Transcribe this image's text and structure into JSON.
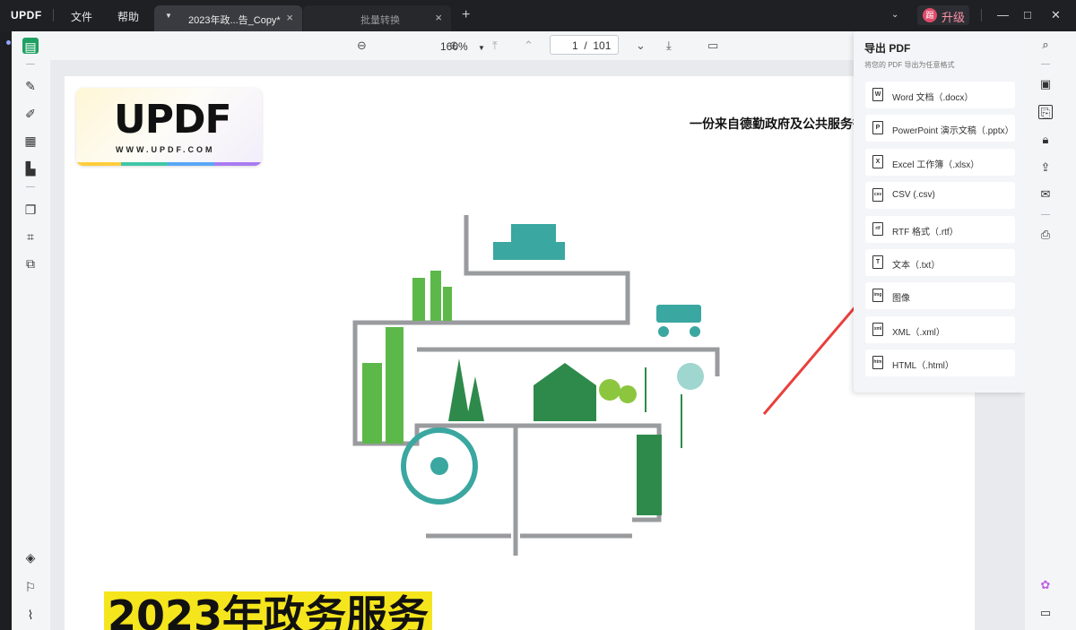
{
  "app": {
    "logo": "UPDF"
  },
  "menu": {
    "file": "文件",
    "help": "帮助"
  },
  "tabs": [
    {
      "label": "2023年政...告_Copy*",
      "active": true
    },
    {
      "label": "批量转换",
      "active": false
    }
  ],
  "window": {
    "upgrade_label": "升级",
    "upgrade_badge": "踢"
  },
  "toolbar": {
    "zoom": "160%",
    "page_current": "1",
    "page_total": "101",
    "page_sep": "/"
  },
  "document": {
    "logo_text": "UPDF",
    "logo_url": "WWW.UPDF.COM",
    "heading": "一份来自德勤政府及公共服务行",
    "title": "2023年政务服务"
  },
  "export_panel": {
    "title": "导出 PDF",
    "subtitle": "将您的 PDF 导出为任意格式",
    "items": [
      {
        "label": "Word 文档（.docx）",
        "icon": "W"
      },
      {
        "label": "PowerPoint 演示文稿（.pptx）",
        "icon": "P"
      },
      {
        "label": "Excel 工作簿（.xlsx）",
        "icon": "X"
      },
      {
        "label": "CSV (.csv)",
        "icon": "csv"
      },
      {
        "label": "RTF 格式（.rtf）",
        "icon": "rtf"
      },
      {
        "label": "文本（.txt）",
        "icon": "T"
      },
      {
        "label": "图像",
        "icon": "img"
      },
      {
        "label": "XML（.xml）",
        "icon": "xml"
      },
      {
        "label": "HTML（.html）",
        "icon": "htm"
      }
    ]
  },
  "colors": {
    "accent": "#1fa062",
    "arrow": "#e8403d",
    "title_highlight": "#f5e51d"
  }
}
